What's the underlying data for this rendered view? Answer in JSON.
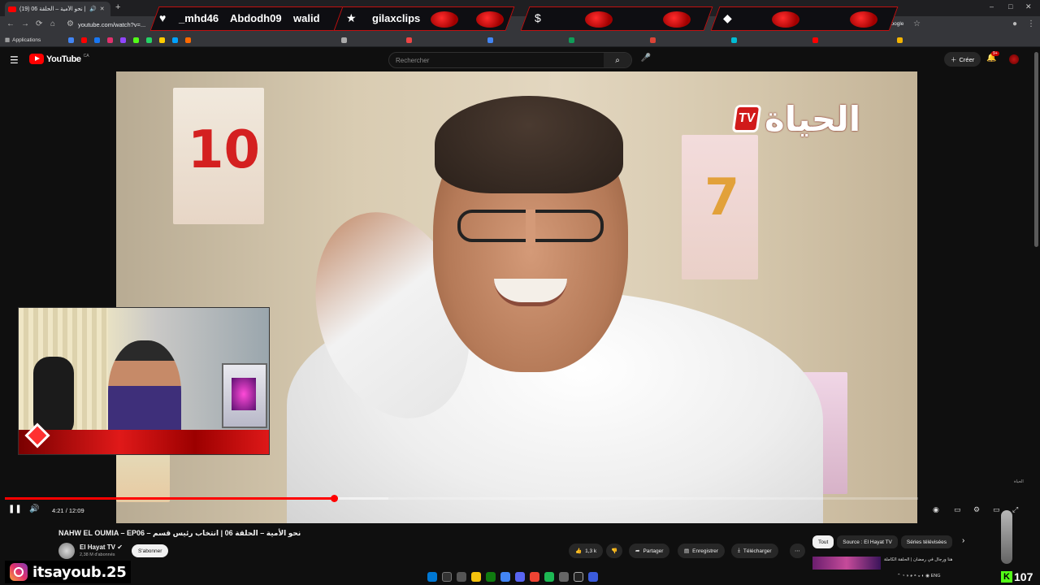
{
  "browser": {
    "tab_title": "(19) نحو الأمية – الحلقة 06 |",
    "new_tab": "+",
    "url": "youtube.com/watch?v=...",
    "bookmarks_label": "Applications",
    "google_label": "à Google",
    "window_controls": [
      "–",
      "□",
      "✕"
    ]
  },
  "stream_overlay": {
    "names": [
      "_mhd46",
      "Abdodh09",
      "walid",
      "gilaxclips"
    ],
    "icons": [
      "heart-icon",
      "star-icon",
      "dollar-icon",
      "diamond-icon"
    ],
    "accent": "#c01010"
  },
  "youtube": {
    "logo": "YouTube",
    "region": "CA",
    "search_placeholder": "Rechercher",
    "create_label": "Créer",
    "notification_count": "9+"
  },
  "video": {
    "channel_watermark_tv": "TV",
    "channel_watermark_ar": "الحياة",
    "small_watermark": "الحياة",
    "poster_numbers": [
      "10",
      "7"
    ],
    "current_time": "4:21",
    "duration": "12:09",
    "time_separator": " / ",
    "progress_fraction": 0.36,
    "buffer_fraction": 0.42
  },
  "meta": {
    "title": "NAHW EL OUMIA – EP06 – نحو الأمية – الحلقة 06 | انتخاب رئيس قسم",
    "channel_name": "El Hayat TV",
    "subscribers": "2,38 M d'abonnés",
    "subscribe_label": "S'abonner",
    "likes": "1,3 k",
    "share_label": "Partager",
    "save_label": "Enregistrer",
    "download_label": "Télécharger",
    "more_label": "⋯"
  },
  "chips": {
    "items": [
      "Tout",
      "Source : El Hayat TV",
      "Séries télévisées"
    ],
    "active_index": 0
  },
  "recommendation": {
    "title": "هنا ورجال في رمضان | الحلقة الكاملة"
  },
  "tray": {
    "lang": "ENG"
  },
  "streamer": {
    "handle": "itsayoub.25",
    "viewer_count": "107",
    "kick_letter": "K"
  }
}
